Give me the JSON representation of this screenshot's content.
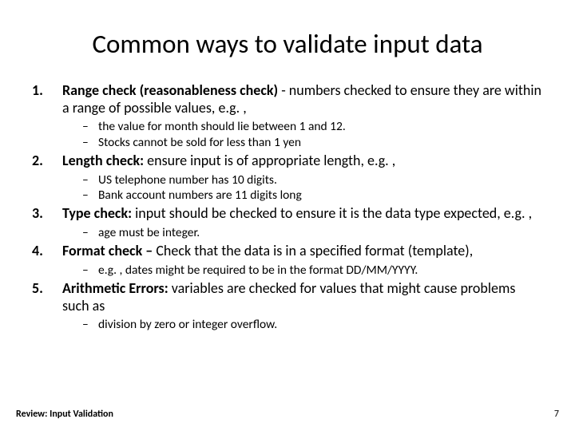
{
  "title": "Common ways to validate input data",
  "items": [
    {
      "bold": "Range check (reasonableness check)",
      "rest": " - numbers checked to ensure they are within a range of possible values, e.g. ,",
      "subs": [
        "the value for month should lie between 1 and 12.",
        "Stocks cannot be sold for less than 1 yen"
      ]
    },
    {
      "bold": "Length check:",
      "rest": "  ensure input is of appropriate length, e.g. ,",
      "subs": [
        "US telephone number has 10 digits.",
        "Bank account numbers are 11 digits long"
      ]
    },
    {
      "bold": "Type check:",
      "rest": " input should be checked to ensure it is the data type expected, e.g. ,",
      "subs": [
        "age must be integer."
      ]
    },
    {
      "bold": "Format check –",
      "rest": " Check that the data is in a specified format (template),",
      "subs": [
        "e.g. , dates might be required to be in the format DD/MM/YYYY."
      ]
    },
    {
      "bold": "Arithmetic Errors:",
      "rest": " variables are checked for values that might cause problems such as",
      "subs": [
        "division by zero or integer overflow."
      ]
    }
  ],
  "footer": {
    "left": "Review: Input Validation",
    "page": "7"
  }
}
